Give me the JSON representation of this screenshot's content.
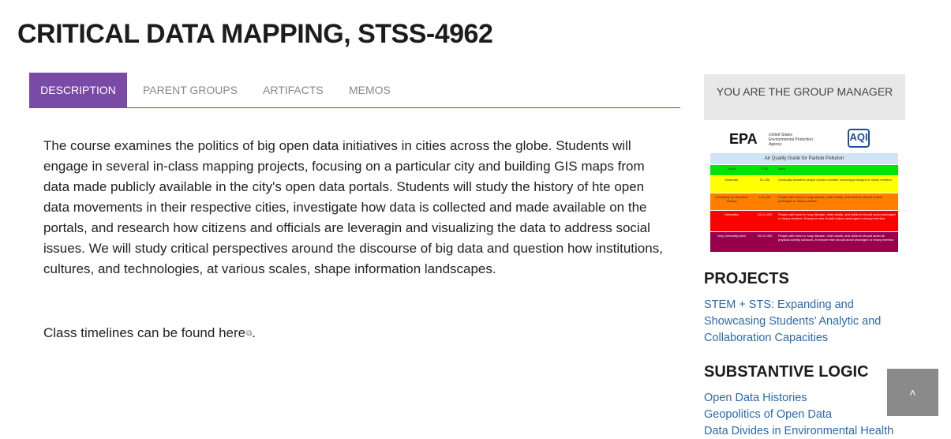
{
  "page": {
    "title": "CRITICAL DATA MAPPING, STSS-4962"
  },
  "tabs": [
    {
      "label": "DESCRIPTION",
      "active": true
    },
    {
      "label": "PARENT GROUPS",
      "active": false
    },
    {
      "label": "ARTIFACTS",
      "active": false
    },
    {
      "label": "MEMOS",
      "active": false
    }
  ],
  "description": {
    "text": "The course examines the politics of big open data initiatives in cities across the globe.  Students will engage in several in-class mapping projects, focusing on a particular city and building GIS maps from data made publicly available in the city's open data portals.  Students will study the history of hte open data movements in their respective cities, investigate how data is collected and made available on the portals, and research how citizens and officials are leveragin and visualizing the data to address social issues.  We will study critical perspectives around the discourse of big data and question how institutions, cultures, and technologies, at various scales, shape information landscapes.",
    "timeline_prefix": "Class timelines can be found ",
    "timeline_link": "here",
    "timeline_suffix": "."
  },
  "sidebar": {
    "manager_label": "YOU ARE THE GROUP MANAGER",
    "aqi": {
      "epa_logo": "EPA",
      "epa_sub": "United States Environmental Protection Agency",
      "aqi_logo": "AQI",
      "table_title": "Air Quality Guide for Particle Pollution",
      "rows": [
        {
          "category": "Good",
          "range": "0-50",
          "note": "None"
        },
        {
          "category": "Moderate",
          "range": "51-100",
          "note": "Unusually sensitive people should consider reducing prolonged or heavy exertion."
        },
        {
          "category": "Unhealthy for Sensitive Groups",
          "range": "101-150",
          "note": "People with heart or lung disease, older adults, and children should reduce prolonged or heavy exertion."
        },
        {
          "category": "Unhealthy",
          "range": "151 to 200",
          "note": "People with heart or lung disease, older adults, and children should avoid prolonged or heavy exertion. Everyone else should reduce prolonged or heavy exertion."
        },
        {
          "category": "Very Unhealthy Alert",
          "range": "201 to 300",
          "note": "People with heart or lung disease, older adults, and children should avoid all physical activity outdoors. Everyone else should avoid prolonged or heavy exertion."
        }
      ]
    },
    "projects_heading": "PROJECTS",
    "projects": [
      "STEM + STS: Expanding and",
      "Showcasing Students’ Analytic and",
      "Collaboration Capacities"
    ],
    "logic_heading": "SUBSTANTIVE LOGIC",
    "logic_links": [
      "Open Data Histories",
      "Geopolitics of Open Data",
      "Data Divides in Environmental Health"
    ]
  },
  "scroll_top": {
    "glyph": "˄"
  },
  "colors": {
    "accent": "#7a4aa7",
    "link": "#2a6aad"
  }
}
